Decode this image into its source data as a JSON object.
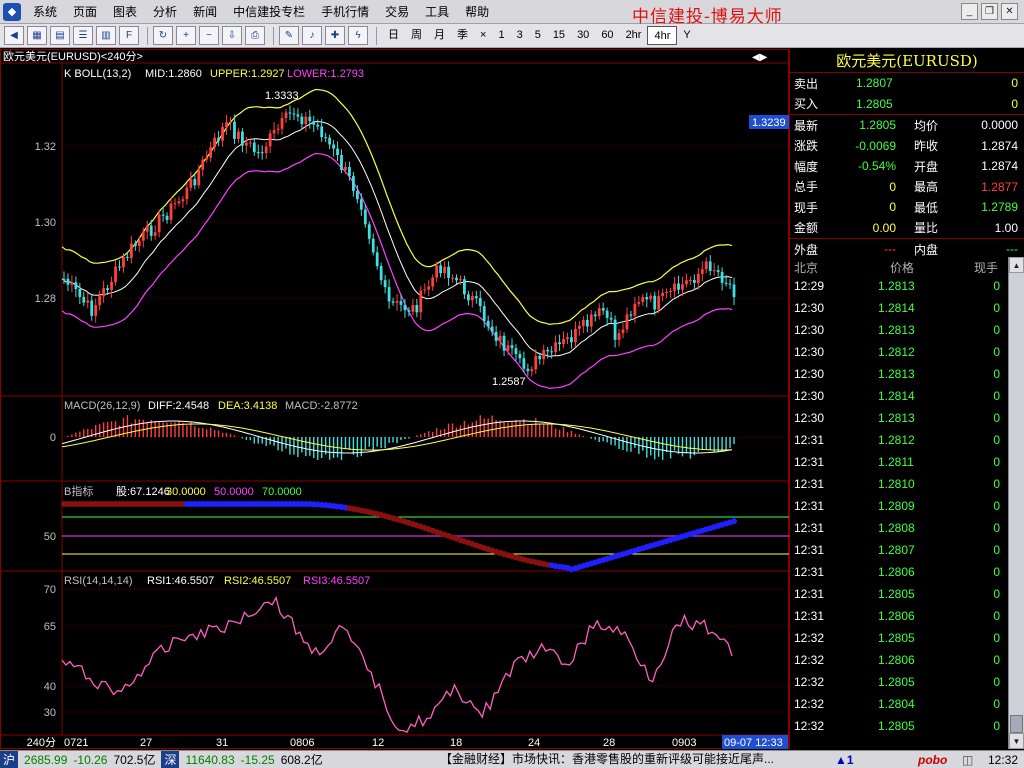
{
  "menu": {
    "items": [
      "系统",
      "页面",
      "图表",
      "分析",
      "新闻",
      "中信建投专栏",
      "手机行情",
      "交易",
      "工具",
      "帮助"
    ],
    "brand": "中信建投-博易大师"
  },
  "toolbar": {
    "periods": [
      "日",
      "周",
      "月",
      "季",
      "×",
      "1",
      "3",
      "5",
      "15",
      "30",
      "60",
      "2hr",
      "4hr",
      "Y"
    ],
    "active_period": "4hr"
  },
  "chart": {
    "instrument_label": "欧元美元(EURUSD)<240分>",
    "main": {
      "indicator": "K  BOLL(13,2)",
      "mid": "MID:1.2860",
      "upper": "UPPER:1.2927",
      "lower": "LOWER:1.2793",
      "y_ticks": [
        "1.32",
        "1.30",
        "1.28"
      ],
      "high_label": "1.3333",
      "low_label": "1.2587",
      "price_tag": "1.3239"
    },
    "macd": {
      "title": "MACD(26,12,9)",
      "diff": "DIFF:2.4548",
      "dea": "DEA:3.4138",
      "macd": "MACD:-2.8772",
      "y_tick": "0"
    },
    "b": {
      "title": "B指标",
      "val": "股:67.1246",
      "l1": "30.0000",
      "l2": "50.0000",
      "l3": "70.0000",
      "y_tick": "50"
    },
    "rsi": {
      "title": "RSI(14,14,14)",
      "r1": "RSI1:46.5507",
      "r2": "RSI2:46.5507",
      "r3": "RSI3:46.5507",
      "y_ticks": [
        "70",
        "65",
        "40",
        "30"
      ]
    },
    "xaxis": {
      "period": "240分",
      "labels": [
        "0721",
        "27",
        "31",
        "0806",
        "12",
        "18",
        "24",
        "28",
        "0903"
      ],
      "cursor": "09-07 12:33"
    }
  },
  "panel": {
    "title": "欧元美元(EURUSD)",
    "sell": {
      "label": "卖出",
      "price": "1.2807",
      "vol": "0"
    },
    "buy": {
      "label": "买入",
      "price": "1.2805",
      "vol": "0"
    },
    "quote_rows": [
      {
        "l": "最新",
        "v": "1.2805",
        "vc": "#40ff40",
        "l2": "均价",
        "v2": "0.0000",
        "v2c": "#ffffff"
      },
      {
        "l": "涨跌",
        "v": "-0.0069",
        "vc": "#40ff40",
        "l2": "昨收",
        "v2": "1.2874",
        "v2c": "#ffffff"
      },
      {
        "l": "幅度",
        "v": "-0.54%",
        "vc": "#40ff40",
        "l2": "开盘",
        "v2": "1.2874",
        "v2c": "#ffffff"
      },
      {
        "l": "总手",
        "v": "0",
        "vc": "#ffff40",
        "l2": "最高",
        "v2": "1.2877",
        "v2c": "#ff4040"
      },
      {
        "l": "现手",
        "v": "0",
        "vc": "#ffff40",
        "l2": "最低",
        "v2": "1.2789",
        "v2c": "#40ff40"
      },
      {
        "l": "金额",
        "v": "0.00",
        "vc": "#ffff40",
        "l2": "量比",
        "v2": "1.00",
        "v2c": "#ffffff"
      },
      {
        "l": "外盘",
        "v": "---",
        "vc": "#ff4040",
        "l2": "内盘",
        "v2": "---",
        "v2c": "#40ff40"
      }
    ],
    "tick_headers": {
      "time": "北京",
      "price": "价格",
      "vol": "现手"
    },
    "ticks": [
      {
        "t": "12:29",
        "p": "1.2813",
        "v": "0"
      },
      {
        "t": "12:30",
        "p": "1.2814",
        "v": "0"
      },
      {
        "t": "12:30",
        "p": "1.2813",
        "v": "0"
      },
      {
        "t": "12:30",
        "p": "1.2812",
        "v": "0"
      },
      {
        "t": "12:30",
        "p": "1.2813",
        "v": "0"
      },
      {
        "t": "12:30",
        "p": "1.2814",
        "v": "0"
      },
      {
        "t": "12:30",
        "p": "1.2813",
        "v": "0"
      },
      {
        "t": "12:31",
        "p": "1.2812",
        "v": "0"
      },
      {
        "t": "12:31",
        "p": "1.2811",
        "v": "0"
      },
      {
        "t": "12:31",
        "p": "1.2810",
        "v": "0"
      },
      {
        "t": "12:31",
        "p": "1.2809",
        "v": "0"
      },
      {
        "t": "12:31",
        "p": "1.2808",
        "v": "0"
      },
      {
        "t": "12:31",
        "p": "1.2807",
        "v": "0"
      },
      {
        "t": "12:31",
        "p": "1.2806",
        "v": "0"
      },
      {
        "t": "12:31",
        "p": "1.2805",
        "v": "0"
      },
      {
        "t": "12:31",
        "p": "1.2806",
        "v": "0"
      },
      {
        "t": "12:32",
        "p": "1.2805",
        "v": "0"
      },
      {
        "t": "12:32",
        "p": "1.2806",
        "v": "0"
      },
      {
        "t": "12:32",
        "p": "1.2805",
        "v": "0"
      },
      {
        "t": "12:32",
        "p": "1.2804",
        "v": "0"
      },
      {
        "t": "12:32",
        "p": "1.2805",
        "v": "0"
      }
    ]
  },
  "status": {
    "sh_label": "沪",
    "sh_index": "2685.99",
    "sh_change": "-10.26",
    "sh_amount": "702.5亿",
    "sz_label": "深",
    "sz_index": "11640.83",
    "sz_change": "-15.25",
    "sz_amount": "608.2亿",
    "news": "【金融财经】市场快讯：香港零售股的重新评级可能接近尾声...",
    "alert": "▲1",
    "pobo": "pobo",
    "time": "12:32"
  }
}
